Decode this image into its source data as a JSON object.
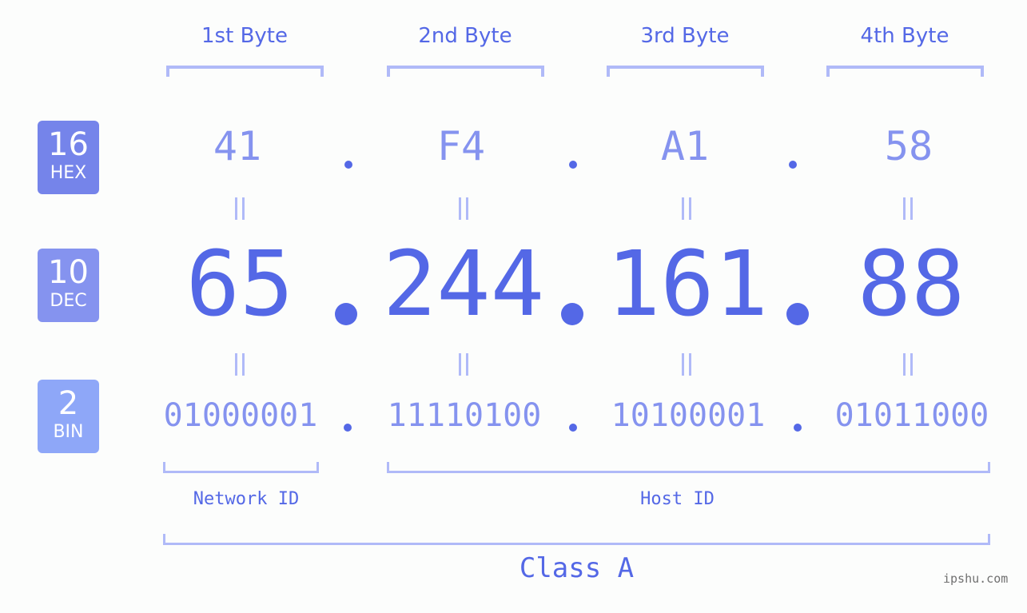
{
  "headers": {
    "bytes": [
      "1st Byte",
      "2nd Byte",
      "3rd Byte",
      "4th Byte"
    ]
  },
  "bases": {
    "hex": {
      "number": "16",
      "label": "HEX"
    },
    "dec": {
      "number": "10",
      "label": "DEC"
    },
    "bin": {
      "number": "2",
      "label": "BIN"
    }
  },
  "ip": {
    "hex": [
      "41",
      "F4",
      "A1",
      "58"
    ],
    "dec": [
      "65",
      "244",
      "161",
      "88"
    ],
    "bin": [
      "01000001",
      "11110100",
      "10100001",
      "01011000"
    ]
  },
  "labels": {
    "network_id": "Network ID",
    "host_id": "Host ID",
    "ip_class": "Class A"
  },
  "watermark": "ipshu.com",
  "colors": {
    "primary": "#5468e6",
    "secondary": "#8593ef",
    "bracket": "#b0baf8",
    "hex_badge": "#7584ea",
    "dec_badge": "#8593ef",
    "bin_badge": "#8ea7f8"
  }
}
